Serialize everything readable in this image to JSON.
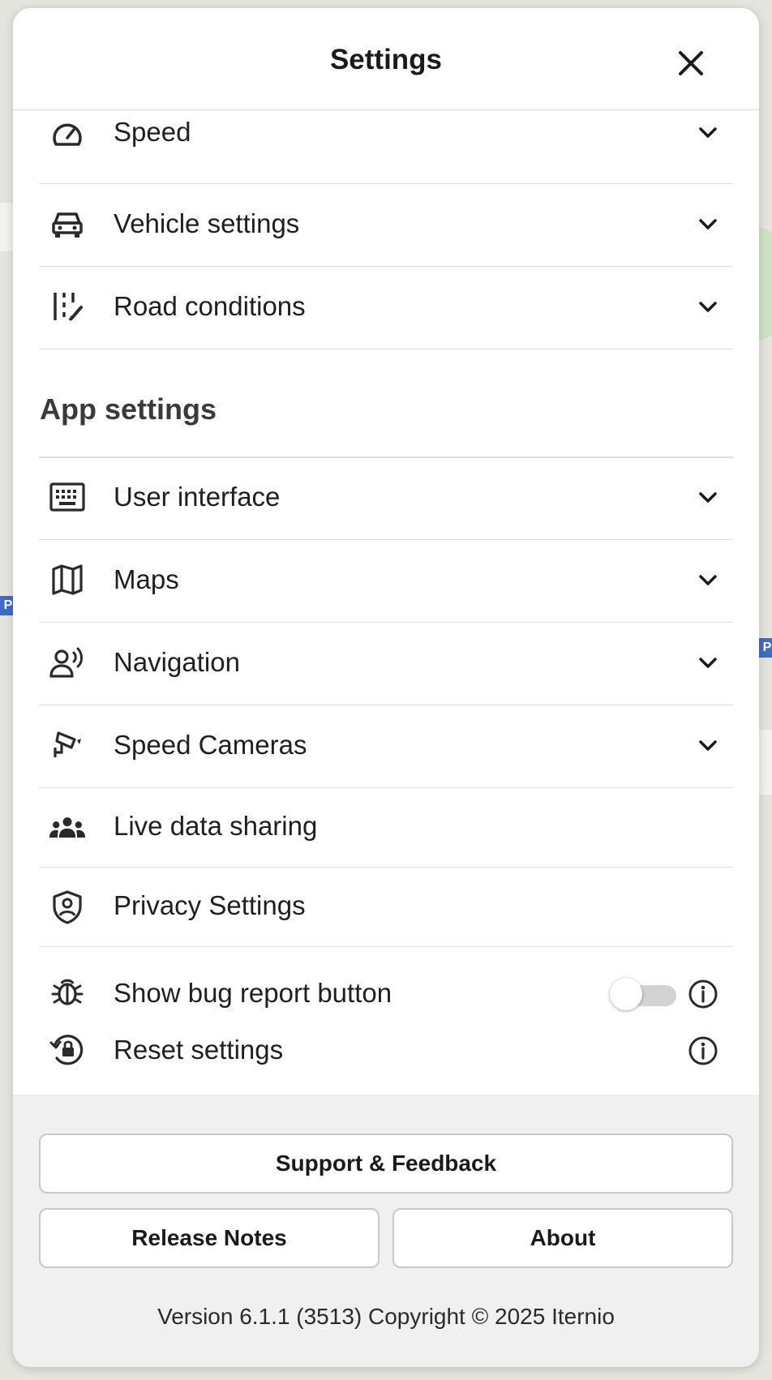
{
  "header": {
    "title": "Settings"
  },
  "top_items": [
    {
      "label": "Speed",
      "icon": "speedometer-icon"
    },
    {
      "label": "Vehicle settings",
      "icon": "car-icon"
    },
    {
      "label": "Road conditions",
      "icon": "road-conditions-icon"
    }
  ],
  "app_settings": {
    "title": "App settings",
    "items": [
      {
        "label": "User interface",
        "icon": "keyboard-icon"
      },
      {
        "label": "Maps",
        "icon": "map-icon"
      },
      {
        "label": "Navigation",
        "icon": "voice-navigation-icon"
      },
      {
        "label": "Speed Cameras",
        "icon": "speed-camera-icon"
      },
      {
        "label": "Live data sharing",
        "icon": "people-group-icon"
      },
      {
        "label": "Privacy Settings",
        "icon": "privacy-shield-icon"
      }
    ]
  },
  "bug_report": {
    "label": "Show bug report button",
    "enabled": false
  },
  "reset": {
    "label": "Reset settings"
  },
  "footer": {
    "support_label": "Support & Feedback",
    "release_notes_label": "Release Notes",
    "about_label": "About",
    "version_text": "Version 6.1.1 (3513) Copyright © 2025 Iternio"
  }
}
